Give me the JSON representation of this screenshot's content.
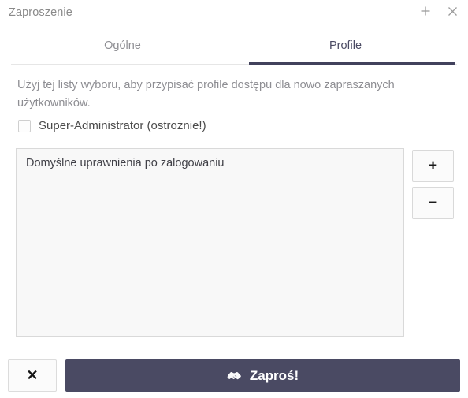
{
  "window": {
    "title": "Zaproszenie",
    "add_icon": "plus-icon",
    "close_icon": "close-icon"
  },
  "tabs": [
    {
      "label": "Ogólne",
      "active": false
    },
    {
      "label": "Profile",
      "active": true
    }
  ],
  "content": {
    "description": "Użyj tej listy wyboru, aby przypisać profile dostępu dla nowo zapraszanych użytkowników.",
    "super_admin_checkbox": {
      "label": "Super-Administrator (ostrożnie!)",
      "checked": false
    },
    "profile_list": {
      "items": [
        "Domyślne uprawnienia po zalogowaniu"
      ]
    },
    "side_buttons": {
      "add_label": "+",
      "remove_label": "−"
    }
  },
  "footer": {
    "cancel_label": "✕",
    "invite_label": "Zaproś!",
    "invite_icon": "handshake-icon"
  },
  "colors": {
    "accent_dark": "#4a4a63",
    "tab_underline": "#41415c",
    "muted_text": "#8e8e93",
    "listbox_bg": "#f8f8f8",
    "border": "#d9d9d9"
  }
}
